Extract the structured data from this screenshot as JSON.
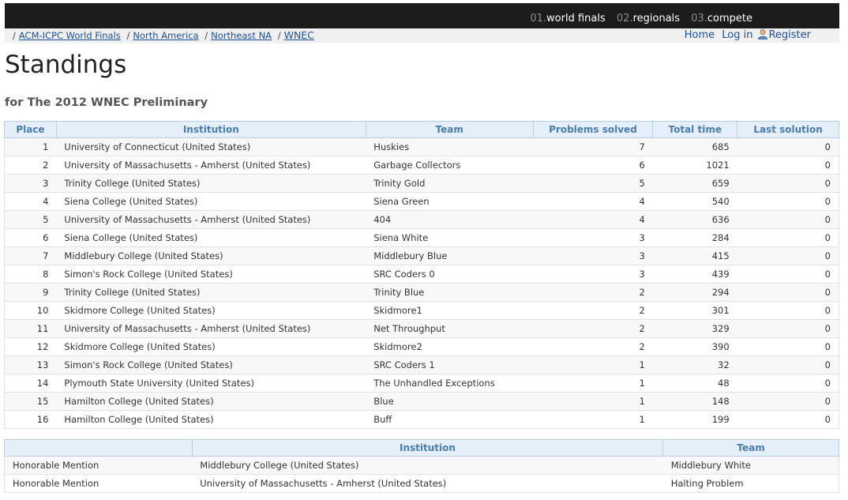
{
  "topnav": [
    {
      "num": "01.",
      "label": "world finals"
    },
    {
      "num": "02.",
      "label": "regionals"
    },
    {
      "num": "03.",
      "label": "compete"
    }
  ],
  "breadcrumb": [
    {
      "label": "ACM-ICPC World Finals"
    },
    {
      "label": "North America"
    },
    {
      "label": "Northeast NA"
    },
    {
      "label": "WNEC"
    }
  ],
  "usernav": {
    "home": "Home",
    "login": "Log in",
    "register": "Register"
  },
  "page_title": "Standings",
  "subtitle": "for The 2012 WNEC Preliminary",
  "standings": {
    "headers": [
      "Place",
      "Institution",
      "Team",
      "Problems solved",
      "Total time",
      "Last solution"
    ],
    "rows": [
      [
        "1",
        "University of Connecticut (United States)",
        "Huskies",
        "7",
        "685",
        "0"
      ],
      [
        "2",
        "University of Massachusetts - Amherst (United States)",
        "Garbage Collectors",
        "6",
        "1021",
        "0"
      ],
      [
        "3",
        "Trinity College (United States)",
        "Trinity Gold",
        "5",
        "659",
        "0"
      ],
      [
        "4",
        "Siena College (United States)",
        "Siena Green",
        "4",
        "540",
        "0"
      ],
      [
        "5",
        "University of Massachusetts - Amherst (United States)",
        "404",
        "4",
        "636",
        "0"
      ],
      [
        "6",
        "Siena College (United States)",
        "Siena White",
        "3",
        "284",
        "0"
      ],
      [
        "7",
        "Middlebury College (United States)",
        "Middlebury Blue",
        "3",
        "415",
        "0"
      ],
      [
        "8",
        "Simon's Rock College (United States)",
        "SRC Coders 0",
        "3",
        "439",
        "0"
      ],
      [
        "9",
        "Trinity College (United States)",
        "Trinity Blue",
        "2",
        "294",
        "0"
      ],
      [
        "10",
        "Skidmore College (United States)",
        "Skidmore1",
        "2",
        "301",
        "0"
      ],
      [
        "11",
        "University of Massachusetts - Amherst (United States)",
        "Net Throughput",
        "2",
        "329",
        "0"
      ],
      [
        "12",
        "Skidmore College (United States)",
        "Skidmore2",
        "2",
        "390",
        "0"
      ],
      [
        "13",
        "Simon's Rock College (United States)",
        "SRC Coders 1",
        "1",
        "32",
        "0"
      ],
      [
        "14",
        "Plymouth State University (United States)",
        "The Unhandled Exceptions",
        "1",
        "48",
        "0"
      ],
      [
        "15",
        "Hamilton College (United States)",
        "Blue",
        "1",
        "148",
        "0"
      ],
      [
        "16",
        "Hamilton College (United States)",
        "Buff",
        "1",
        "199",
        "0"
      ]
    ]
  },
  "mentions": {
    "headers": [
      "",
      "Institution",
      "Team"
    ],
    "rows": [
      [
        "Honorable Mention",
        "Middlebury College (United States)",
        "Middlebury White"
      ],
      [
        "Honorable Mention",
        "University of Massachusetts - Amherst (United States)",
        "Halting Problem"
      ]
    ]
  },
  "colors": {
    "header_bg": "#e4eff9",
    "header_text": "#4a7cad",
    "link": "#1a4f9c",
    "topbar": "#1c1c1c"
  }
}
